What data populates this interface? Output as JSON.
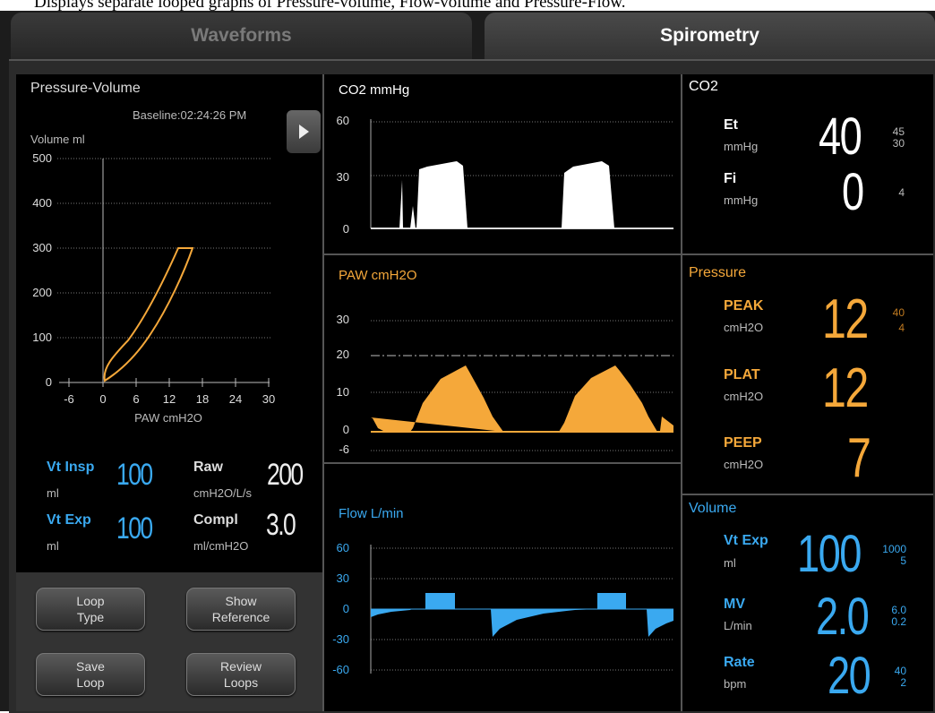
{
  "caption": "Displays separate looped graphs of Pressure-volume, Flow-volume and Pressure-Flow.",
  "tabs": {
    "waveforms": "Waveforms",
    "spirometry": "Spirometry"
  },
  "loop": {
    "title": "Pressure-Volume",
    "baseline": "Baseline:02:24:26 PM",
    "ylabel": "Volume  ml",
    "xlabel": "PAW  cmH2O",
    "y_ticks": [
      "500",
      "400",
      "300",
      "200",
      "100",
      "0"
    ],
    "x_ticks": [
      "-6",
      "0",
      "6",
      "12",
      "18",
      "24",
      "30"
    ],
    "loop_color": "#f5a83a"
  },
  "metrics": {
    "vt_insp": {
      "label": "Vt Insp",
      "unit": "ml",
      "value": "100"
    },
    "vt_exp": {
      "label": "Vt Exp",
      "unit": "ml",
      "value": "100"
    },
    "raw": {
      "label": "Raw",
      "unit": "cmH2O/L/s",
      "value": "200"
    },
    "compl": {
      "label": "Compl",
      "unit": "ml/cmH2O",
      "value": "3.0"
    }
  },
  "buttons": {
    "loop_type": [
      "Loop",
      "Type"
    ],
    "show_reference": [
      "Show",
      "Reference"
    ],
    "save_loop": [
      "Save",
      "Loop"
    ],
    "review_loops": [
      "Review",
      "Loops"
    ]
  },
  "waves": {
    "co2": {
      "title": "CO2  mmHg",
      "ticks": [
        "60",
        "30",
        "0"
      ],
      "color": "#ffffff"
    },
    "paw": {
      "title": "PAW  cmH2O",
      "ticks": [
        "30",
        "20",
        "10",
        "0",
        "-6"
      ],
      "color": "#f5a83a"
    },
    "flow": {
      "title": "Flow  L/min",
      "ticks": [
        "60",
        "30",
        "0",
        "-30",
        "-60"
      ],
      "color": "#3aa9f0"
    }
  },
  "numerics": {
    "co2": {
      "title": "CO2",
      "et": {
        "label": "Et",
        "unit": "mmHg",
        "value": "40",
        "hi": "45",
        "lo": "30"
      },
      "fi": {
        "label": "Fi",
        "unit": "mmHg",
        "value": "0",
        "hi": "4"
      }
    },
    "pressure": {
      "title": "Pressure",
      "peak": {
        "label": "PEAK",
        "unit": "cmH2O",
        "value": "12",
        "hi": "40",
        "lo": "4"
      },
      "plat": {
        "label": "PLAT",
        "unit": "cmH2O",
        "value": "12"
      },
      "peep": {
        "label": "PEEP",
        "unit": "cmH2O",
        "value": "7"
      }
    },
    "volume": {
      "title": "Volume",
      "vt_exp": {
        "label": "Vt Exp",
        "unit": "ml",
        "value": "100",
        "hi": "1000",
        "lo": "5"
      },
      "mv": {
        "label": "MV",
        "unit": "L/min",
        "value": "2.0",
        "hi": "6.0",
        "lo": "0.2"
      },
      "rate": {
        "label": "Rate",
        "unit": "bpm",
        "value": "20",
        "hi": "40",
        "lo": "2"
      }
    }
  },
  "colors": {
    "orange": "#f5a83a",
    "blue": "#3aa9f0",
    "white": "#ffffff"
  }
}
